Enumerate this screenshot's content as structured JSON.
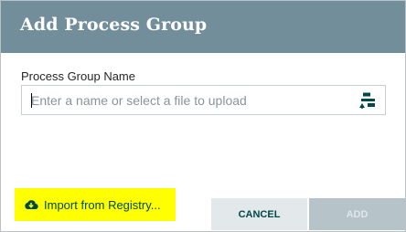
{
  "dialog": {
    "title": "Add Process Group",
    "field_label": "Process Group Name",
    "input": {
      "value": "",
      "placeholder": "Enter a name or select a file to upload"
    },
    "upload_icon": "upload-file-icon",
    "import_button": {
      "icon": "cloud-download-icon",
      "label": "Import from Registry..."
    },
    "cancel_label": "CANCEL",
    "add_label": "ADD"
  },
  "colors": {
    "header": "#728e9b",
    "highlight": "#ffff00",
    "button_text": "#004849",
    "cancel_bg": "#e3e8eb",
    "add_bg_disabled": "#b6c4ca"
  }
}
